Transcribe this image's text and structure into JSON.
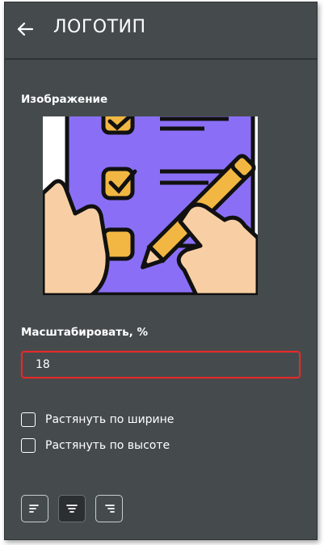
{
  "header": {
    "back_icon": "arrow-left-icon",
    "title": "ЛОГОТИП"
  },
  "image_section": {
    "label": "Изображение"
  },
  "scale": {
    "label": "Масштабировать, %",
    "value": "18"
  },
  "options": [
    {
      "label": "Растянуть по ширине",
      "checked": false
    },
    {
      "label": "Растянуть по высоте",
      "checked": false
    }
  ],
  "alignment": {
    "buttons": [
      {
        "icon": "align-left-icon",
        "active": false
      },
      {
        "icon": "align-center-icon",
        "active": true
      },
      {
        "icon": "align-right-icon",
        "active": false
      }
    ]
  },
  "colors": {
    "panel_bg": "#454b4d",
    "error_border": "#e32a2a",
    "illustration_purple": "#8a6ff6",
    "illustration_yellow": "#f2b742",
    "illustration_skin": "#f8cfa4"
  }
}
